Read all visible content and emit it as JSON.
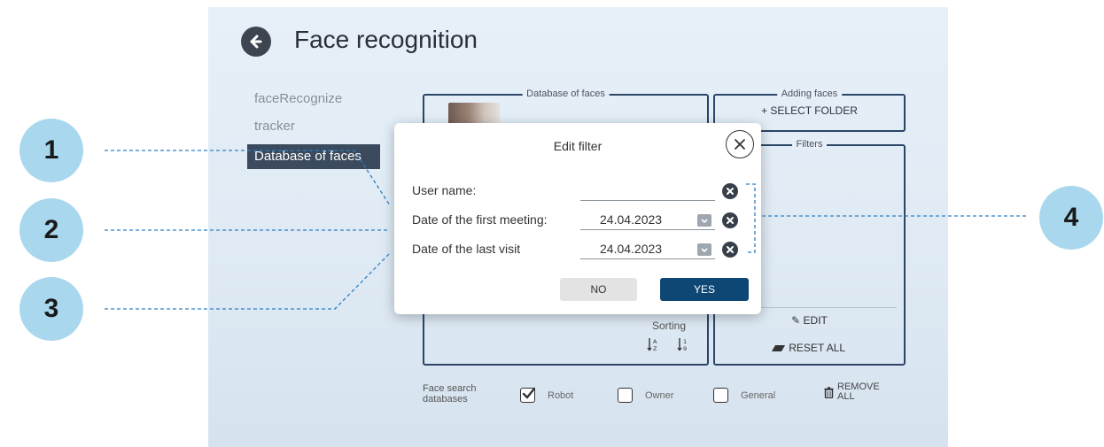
{
  "app": {
    "title": "Face recognition",
    "back_icon": "arrow-left-icon"
  },
  "sidebar": {
    "items": [
      {
        "label": "faceRecognize",
        "active": false
      },
      {
        "label": "tracker",
        "active": false
      },
      {
        "label": "Database of faces",
        "active": true
      }
    ]
  },
  "panels": {
    "database_of_faces": {
      "legend": "Database of faces"
    },
    "adding_faces": {
      "legend": "Adding faces",
      "select_folder": "+ SELECT FOLDER"
    },
    "filters": {
      "legend": "Filters",
      "edit": "EDIT",
      "reset_all": "RESET ALL"
    },
    "sorting": {
      "label": "Sorting",
      "sort_alpha": "A→Z",
      "sort_numeric": "1→9"
    }
  },
  "bottom_bar": {
    "label": "Face search databases",
    "label_line1": "Face search",
    "label_line2": "databases",
    "checkboxes": [
      {
        "label": "Robot",
        "checked": true
      },
      {
        "label": "Owner",
        "checked": false
      },
      {
        "label": "General",
        "checked": false
      }
    ],
    "remove_all_line1": "REMOVE",
    "remove_all_line2": "ALL"
  },
  "modal": {
    "title": "Edit filter",
    "fields": [
      {
        "label": "User name:",
        "value": ""
      },
      {
        "label": "Date of the first meeting:",
        "value": "24.04.2023"
      },
      {
        "label": "Date of the last visit",
        "value": "24.04.2023"
      }
    ],
    "no_label": "NO",
    "yes_label": "YES"
  },
  "callouts": [
    "1",
    "2",
    "3",
    "4"
  ],
  "colors": {
    "accent": "#0f4774",
    "sidebar_active": "#3b4a5c",
    "callout": "#a9d8ee",
    "leader_line": "#2e7fc4"
  }
}
